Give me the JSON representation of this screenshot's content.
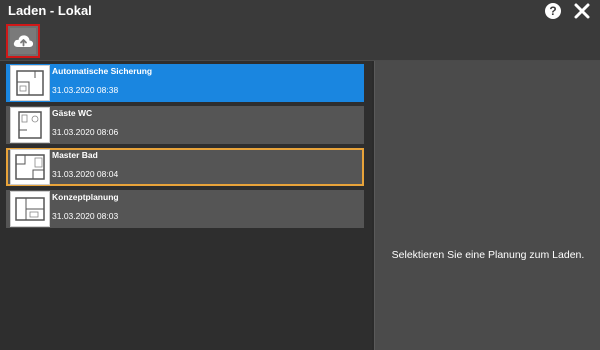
{
  "window": {
    "title": "Laden - Lokal",
    "help_label": "?",
    "close_icon": "close-icon"
  },
  "toolbar": {
    "upload_icon": "cloud-upload-icon"
  },
  "plans": [
    {
      "name": "Automatische Sicherung",
      "date": "31.03.2020 08:38",
      "state": "selected"
    },
    {
      "name": "Gäste WC",
      "date": "31.03.2020 08:06",
      "state": "normal"
    },
    {
      "name": "Master Bad",
      "date": "31.03.2020 08:04",
      "state": "focused"
    },
    {
      "name": "Konzeptplanung",
      "date": "31.03.2020 08:03",
      "state": "normal"
    }
  ],
  "detail": {
    "empty_message": "Selektieren Sie eine Planung zum Laden."
  },
  "colors": {
    "selected": "#1a86e0",
    "focus_border": "#e8a33a",
    "highlight_border": "#d01818"
  }
}
